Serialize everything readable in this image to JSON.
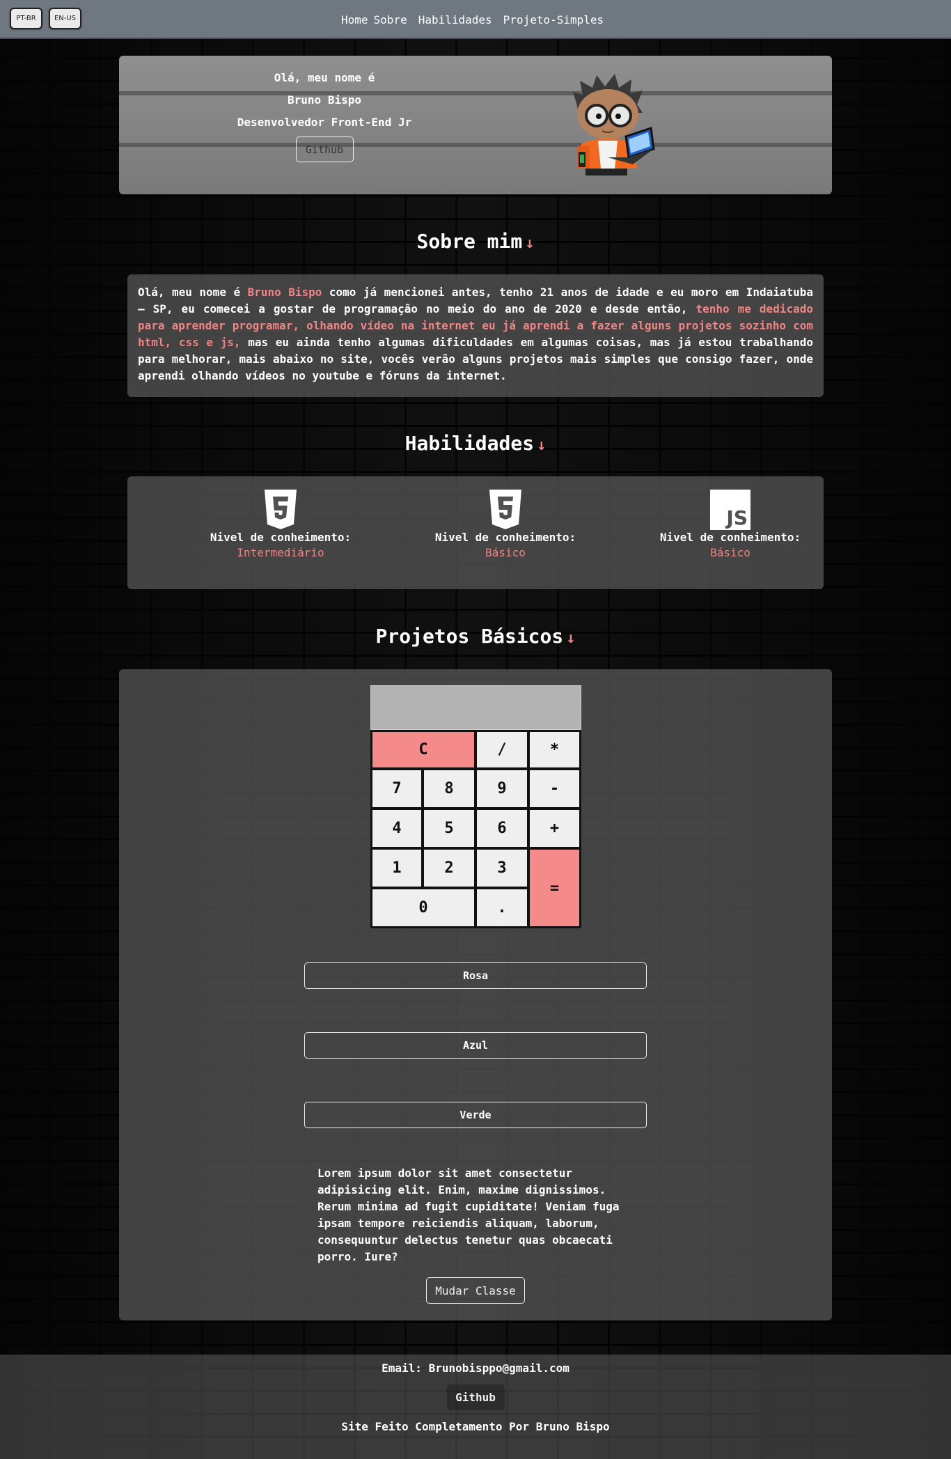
{
  "nav": {
    "lang_pt": "PT-BR",
    "lang_en": "EN-US",
    "links": [
      "Home",
      "Sobre",
      "Habilidades",
      "Projeto-Simples"
    ]
  },
  "hero": {
    "greeting": "Olá, meu nome é",
    "name": "Bruno Bispo",
    "role": "Desenvolvedor Front-End Jr",
    "github_label": "Github"
  },
  "about": {
    "title": "Sobre mim",
    "arrow": "↓",
    "text_1": "Olá, meu nome é ",
    "text_name": "Bruno Bispo",
    "text_2": " como já mencionei antes, tenho 21 anos de idade e eu moro em Indaiatuba – SP, eu comecei a gostar de programação no meio do ano de 2020 e desde então, ",
    "text_highlight": "tenho me dedicado para aprender programar, olhando vídeo na internet eu já aprendi a fazer alguns projetos sozinho com html, css e js,",
    "text_3": " mas eu ainda tenho algumas dificuldades em algumas coisas, mas já estou trabalhando para melhorar, mais abaixo no site, vocês verão alguns projetos mais simples que consigo fazer, onde aprendi olhando vídeos no youtube e fóruns da internet."
  },
  "skills": {
    "title": "Habilidades",
    "arrow": "↓",
    "items": [
      {
        "icon": "html5-icon",
        "label": "Nivel de conheimento:",
        "level": "Intermediário"
      },
      {
        "icon": "css3-icon",
        "label": "Nivel de conheimento:",
        "level": "Básico"
      },
      {
        "icon": "js-icon",
        "label": "Nivel de conheimento:",
        "level": "Básico",
        "badge": "JS"
      }
    ]
  },
  "projects": {
    "title": "Projetos Básicos",
    "arrow": "↓",
    "calculator": {
      "display": "",
      "keys": {
        "clear": "C",
        "divide": "/",
        "multiply": "*",
        "k7": "7",
        "k8": "8",
        "k9": "9",
        "minus": "-",
        "k4": "4",
        "k5": "5",
        "k6": "6",
        "plus": "+",
        "k1": "1",
        "k2": "2",
        "k3": "3",
        "equals": "=",
        "k0": "0",
        "dot": "."
      }
    },
    "color_buttons": [
      "Rosa",
      "Azul",
      "Verde"
    ],
    "lorem": "Lorem ipsum dolor sit amet consectetur adipisicing elit. Enim, maxime dignissimos. Rerum minima ad fugit cupiditate! Veniam fuga ipsam tempore reiciendis aliquam, laborum, consequuntur delectus tenetur quas obcaecati porro. Iure?",
    "change_class_label": "Mudar Classe"
  },
  "footer": {
    "email": "Email: Brunobisppo@gmail.com",
    "github_label": "Github",
    "credit": "Site Feito Completamento Por Bruno Bispo"
  },
  "colors": {
    "accent_pink": "#f08484",
    "nav_bg": "#6f7880",
    "calc_key_pink": "#f48a8a"
  }
}
